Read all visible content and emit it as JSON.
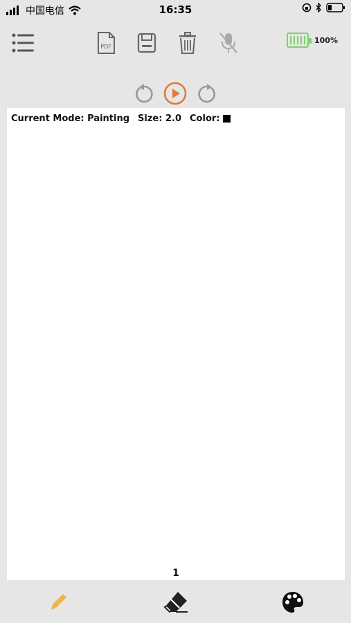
{
  "status_bar": {
    "carrier": "中国电信",
    "time": "16:35"
  },
  "toolbar": {
    "menu_icon": "hamburger-menu-icon",
    "pdf_icon": "pdf-file-icon",
    "pdf_label": "PDF",
    "save_icon": "save-icon",
    "delete_icon": "trash-icon",
    "mic_icon": "mic-off-icon",
    "battery_percent": "100%",
    "battery_level": 1.0
  },
  "playback": {
    "undo_icon": "undo-icon",
    "play_icon": "play-icon",
    "redo_icon": "redo-icon"
  },
  "canvas": {
    "mode_label": "Current Mode: Painting",
    "size_label": "Size: 2.0",
    "color_label": "Color:",
    "current_color": "#000000",
    "page_number": "1"
  },
  "bottom_bar": {
    "pencil_icon": "pencil-icon",
    "eraser_icon": "eraser-icon",
    "palette_icon": "palette-icon"
  },
  "colors": {
    "accent": "#e07a3a",
    "pencil": "#f0b44a",
    "battery": "#7dd36b",
    "icon_gray": "#666666",
    "background": "#e6e6e6"
  }
}
